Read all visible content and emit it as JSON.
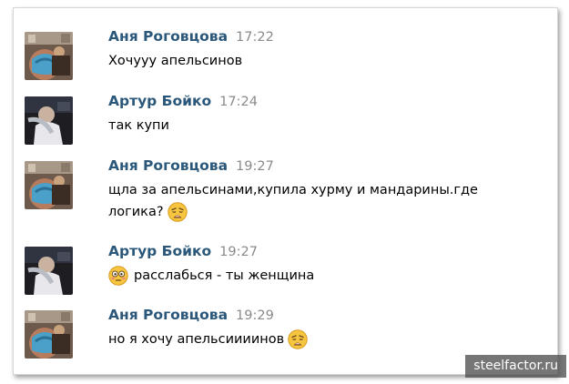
{
  "messages": [
    {
      "author": "Аня Роговцова",
      "time": "17:22",
      "line1": "Хочууу апельсинов",
      "avatar": "anya-avatar"
    },
    {
      "author": "Артур Бойко",
      "time": "17:24",
      "line1": "так купи",
      "avatar": "artur-avatar"
    },
    {
      "author": "Аня Роговцова",
      "time": "19:27",
      "line1": "щла за апельсинами,купила хурму и мандарины.где",
      "line2": "логика?",
      "emoji": "weary-face-icon",
      "avatar": "anya-avatar"
    },
    {
      "author": "Артур Бойко",
      "time": "19:27",
      "line1": "расслабься - ты женщина",
      "emoji": "flushed-face-icon",
      "avatar": "artur-avatar"
    },
    {
      "author": "Аня Роговцова",
      "time": "19:29",
      "line1": "но я хочу апельсиииинов",
      "emoji": "weary-face-icon",
      "avatar": "anya-avatar"
    }
  ],
  "watermark": "steelfactor.ru",
  "colors": {
    "author": "#2b587a",
    "time": "#8a8a8a",
    "text": "#000000",
    "emoji": "#f7c640"
  }
}
